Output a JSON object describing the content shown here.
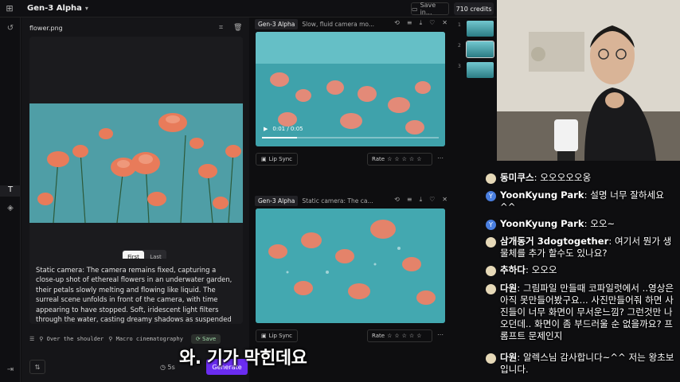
{
  "topbar": {
    "app_title": "Gen-3 Alpha",
    "save_label": "Save in...",
    "credits": "710 credits"
  },
  "left_panel": {
    "filename": "flower.png",
    "toggle": {
      "first": "First",
      "last": "Last"
    },
    "prompt": "Static camera: The camera remains fixed, capturing a close-up shot of ethereal flowers in an underwater garden, their petals slowly melting and flowing like liquid. The surreal scene unfolds in front of the camera, with time appearing to have stopped. Soft, iridescent light filters through the water, casting dreamy shadows as suspended particles float lazily, creating a sense of calm and",
    "chips": [
      "Over the shoulder",
      "Macro cinematography"
    ],
    "save_chip": "Save",
    "duration": "5s",
    "generate": "Generate"
  },
  "gallery": {
    "cards": [
      {
        "model": "Gen-3 Alpha",
        "prompt": "Slow, fluid camera mo...",
        "time": "0:01 / 0:05",
        "lipsync": "Lip Sync",
        "rate": "Rate"
      },
      {
        "model": "Gen-3 Alpha",
        "prompt": "Static camera: The ca...",
        "lipsync": "Lip Sync",
        "rate": "Rate"
      }
    ]
  },
  "thumbnails": {
    "labels": [
      "1",
      "2",
      "3"
    ]
  },
  "chat": {
    "messages": [
      {
        "name": "동미쿠스",
        "text": "오오오오오옹"
      },
      {
        "name": "YoonKyung Park",
        "text": "설명 너무 잘하세요 ^^"
      },
      {
        "name": "YoonKyung Park",
        "text": "오오~"
      },
      {
        "name": "삼개동거 3dogtogether",
        "text": "여기서 뭔가 생물체를 추가 할수도 있나요?"
      },
      {
        "name": "추하다",
        "text": "오오오"
      },
      {
        "name": "다원",
        "text": "그림파일 만들때 코파일럿에서 ..영상은 아직 못만들어봤구요... 사진만들어줘 하면 사진들이 너무 화면이 무서운느낌? 그런것만 나오던데.. 화면이 좀 부드러울 순 없을까요? 프롬프트 문제인지"
      },
      {
        "name": "다원",
        "text": "알렉스님 감사합니다~^^ 저는 왕초보입니다."
      }
    ]
  },
  "subtitle": "와. 기가 막힌데요",
  "colors": {
    "accent": "#6a2cf0",
    "background": "#0e0e10"
  }
}
